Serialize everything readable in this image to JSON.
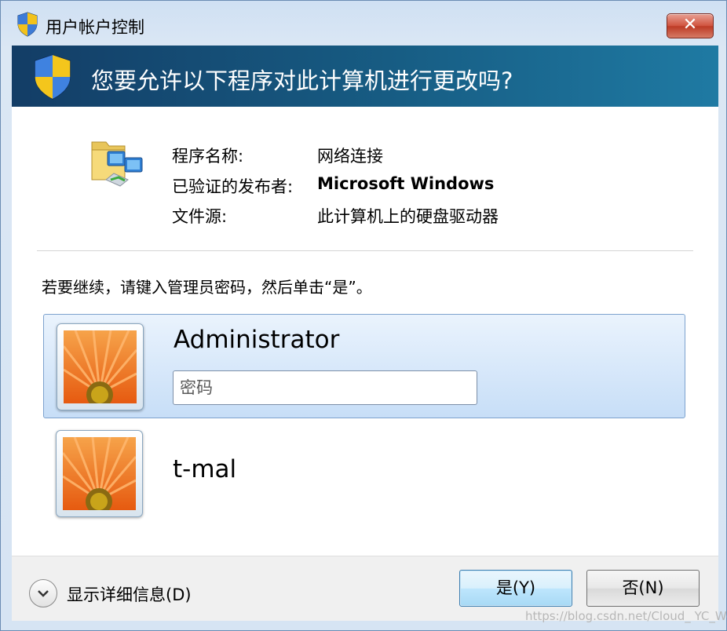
{
  "window": {
    "title": "用户帐户控制",
    "close_label": "✕"
  },
  "banner": {
    "question": "您要允许以下程序对此计算机进行更改吗?"
  },
  "program_info": {
    "rows": [
      {
        "label": "程序名称:",
        "value": "网络连接"
      },
      {
        "label": "已验证的发布者:",
        "value": "Microsoft Windows"
      },
      {
        "label": "文件源:",
        "value": "此计算机上的硬盘驱动器"
      }
    ],
    "icon": "network-connections-icon"
  },
  "instruction": "若要继续，请键入管理员密码，然后单击“是”。",
  "accounts": [
    {
      "name": "Administrator",
      "selected": true,
      "password_placeholder": "密码"
    },
    {
      "name": "t-mal",
      "selected": false
    }
  ],
  "footer": {
    "details_label": "显示详细信息(D)",
    "yes_label": "是(Y)",
    "no_label": "否(N)"
  },
  "watermark": "https://blog.csdn.net/Cloud_ YC_Wei",
  "colors": {
    "banner": "#175d84",
    "close_button": "#c7432d",
    "selected_account": "#c7def7"
  }
}
